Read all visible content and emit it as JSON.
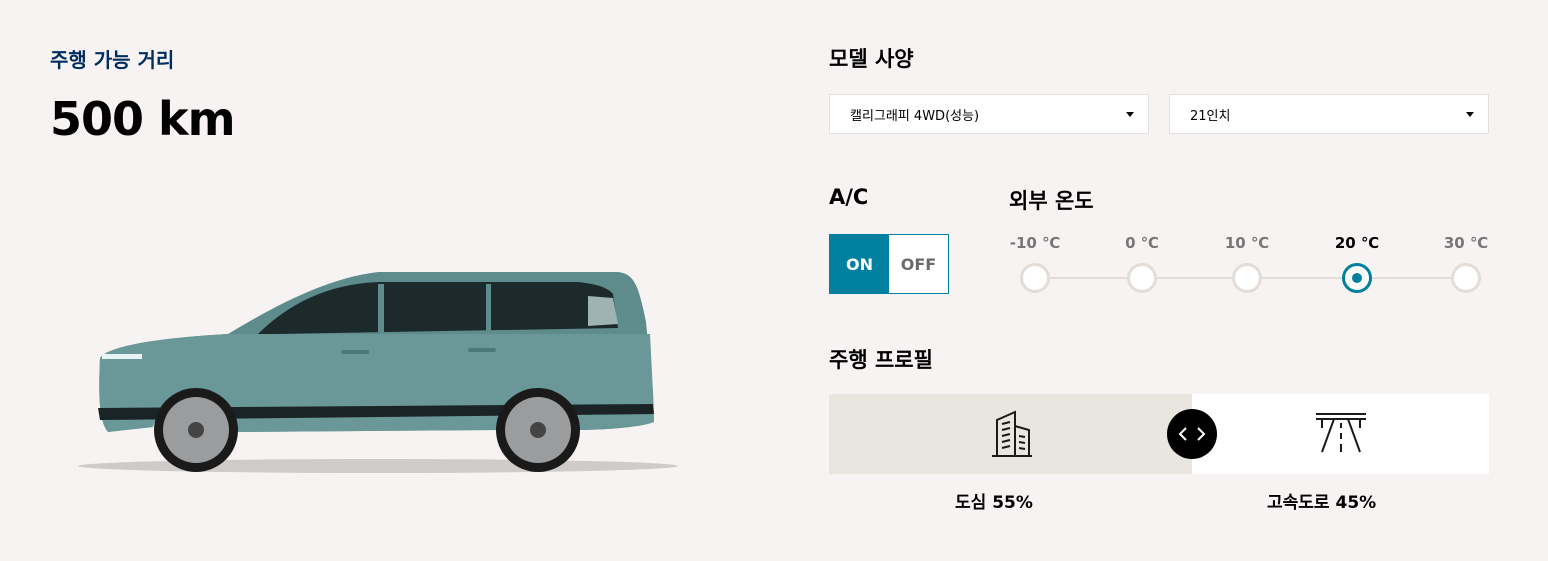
{
  "range": {
    "label": "주행 가능 거리",
    "value": "500 km"
  },
  "model": {
    "title": "모델 사양",
    "trim": {
      "selected": "캘리그래피 4WD(성능)"
    },
    "wheel": {
      "selected": "21인치"
    }
  },
  "ac": {
    "title": "A/C",
    "on_label": "ON",
    "off_label": "OFF",
    "selected": "ON"
  },
  "temperature": {
    "title": "외부 온도",
    "options": [
      "-10 ℃",
      "0 ℃",
      "10 ℃",
      "20 ℃",
      "30 ℃"
    ],
    "selected": "20 ℃"
  },
  "profile": {
    "title": "주행 프로필",
    "city": {
      "label": "도심",
      "percent": "55%"
    },
    "highway": {
      "label": "고속도로",
      "percent": "45%"
    },
    "city_share": 0.55
  },
  "colors": {
    "accent": "#00809e",
    "brand_navy": "#002c5f",
    "background": "#f6f3f2",
    "city_fill": "#e9e5df"
  },
  "icons": [
    "city-buildings-icon",
    "highway-icon",
    "slider-arrows-icon",
    "dropdown-caret-icon"
  ]
}
